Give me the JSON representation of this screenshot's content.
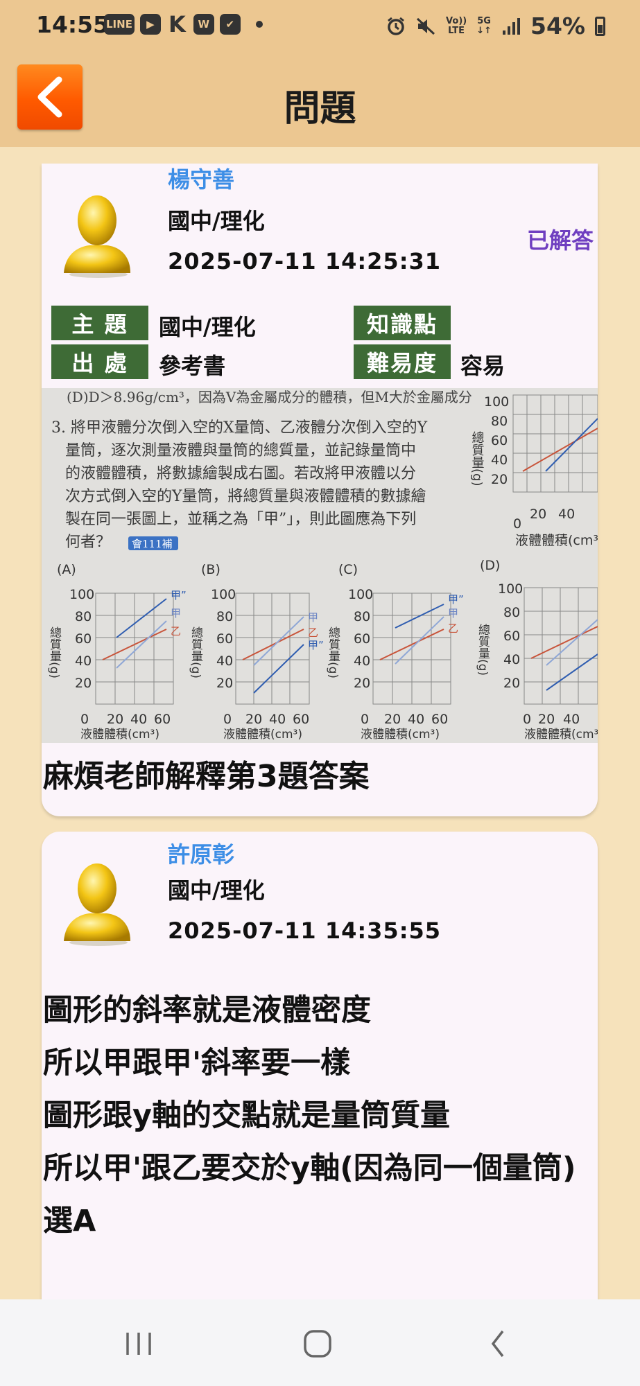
{
  "status_bar": {
    "time": "14:55",
    "left_icons": [
      "LINE",
      "▶",
      "K",
      "W",
      "✔"
    ],
    "right_icons": [
      "alarm-icon",
      "mute-icon"
    ],
    "volte": [
      "Vo))",
      "LTE"
    ],
    "network": [
      "5G",
      "↓↑"
    ],
    "battery": "54%"
  },
  "header": {
    "title": "問題"
  },
  "question": {
    "author": "楊守善",
    "subject": "國中/理化",
    "timestamp": "2025-07-11 14:25:31",
    "status": "已解答",
    "meta": {
      "topic_label": "主 題",
      "topic_value": "國中/理化",
      "knowledge_label": "知識點",
      "knowledge_value": "",
      "source_label": "出 處",
      "source_value": "參考書",
      "difficulty_label": "難易度",
      "difficulty_value": "容易"
    },
    "image": {
      "line0": "(D)D＞8.96g/cm³，因為V為金屬成分的體積，但M大於金屬成分",
      "lines": [
        "3. 將甲液體分次倒入空的X量筒、乙液體分次倒入空的Y",
        "量筒，逐次測量液體與量筒的總質量，並記錄量筒中",
        "的液體體積，將數據繪製成右圖。若改將甲液體以分",
        "次方式倒入空的Y量筒，將總質量與液體體積的數據繪",
        "製在同一張圖上，並稱之為「甲”」，則此圖應為下列",
        "何者？"
      ],
      "badge": "會111補",
      "ylabel": "總質量(g)",
      "xlabel": "液體體積(cm³)",
      "yticks": [
        "100",
        "80",
        "60",
        "40",
        "20",
        "0"
      ],
      "xticks": [
        "20",
        "40",
        "60"
      ],
      "choices": [
        "(A)",
        "(B)",
        "(C)",
        "(D)"
      ],
      "series_a": "甲",
      "series_b": "乙",
      "series_c": "甲”"
    },
    "text": "麻煩老師解釋第3題答案"
  },
  "answer": {
    "author": "許原彰",
    "subject": "國中/理化",
    "timestamp": "2025-07-11 14:35:55",
    "lines": [
      "圖形的斜率就是液體密度",
      "所以甲跟甲'斜率要一樣",
      "圖形跟y軸的交點就是量筒質量",
      "所以甲'跟乙要交於y軸(因為同一個量筒)",
      "選A"
    ]
  },
  "colors": {
    "header_bg": "#ecc791",
    "page_bg": "#f6e2bb",
    "author": "#3d8ee6",
    "answered": "#6f3fc0",
    "tag_bg": "#3e6b36"
  }
}
